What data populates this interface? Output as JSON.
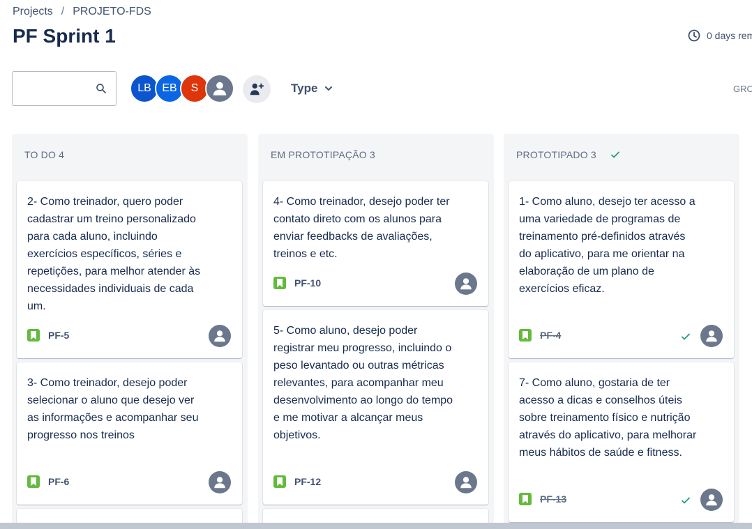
{
  "breadcrumb": {
    "projects": "Projects",
    "separator": "/",
    "project": "PROJETO-FDS"
  },
  "page_title": "PF Sprint 1",
  "sprint_time": {
    "text": "0 days rem",
    "icon": "clock-icon"
  },
  "search": {
    "value": "",
    "placeholder": ""
  },
  "avatars": [
    {
      "initials": "LB",
      "color": "#0c55cf"
    },
    {
      "initials": "EB",
      "color": "#0b66e4"
    },
    {
      "initials": "S",
      "color": "#de350b"
    },
    {
      "initials": "",
      "icon": "user-icon",
      "color": "#6b778c"
    }
  ],
  "filters": {
    "type_label": "Type",
    "group_label": "GRO"
  },
  "colors": {
    "story": "#63ba3c",
    "done_check": "#22a06b",
    "column_bg": "#f4f5f7"
  },
  "columns": [
    {
      "title": "TO DO 4",
      "cards": [
        {
          "text": "2- Como treinador, quero poder cadastrar um treino personalizado para cada aluno, incluindo exercícios específicos, séries e repetições, para melhor atender às necessidades individuais de cada um.",
          "key": "PF-5",
          "done": false
        },
        {
          "text": "3- Como treinador, desejo poder selecionar o aluno que desejo ver as informações e acompanhar seu progresso nos treinos",
          "key": "PF-6",
          "done": false
        }
      ]
    },
    {
      "title": "EM PROTOTIPAÇÃO 3",
      "cards": [
        {
          "text": "4- Como treinador, desejo poder ter contato direto com os alunos para enviar feedbacks de avaliações, treinos e etc.",
          "key": "PF-10",
          "done": false
        },
        {
          "text": "5- Como aluno, desejo poder registrar meu progresso, incluindo o peso levantado ou outras métricas relevantes, para acompanhar meu desenvolvimento ao longo do tempo e me motivar a alcançar meus objetivos.",
          "key": "PF-12",
          "done": false
        }
      ]
    },
    {
      "title": "PROTOTIPADO 3",
      "cards": [
        {
          "text": "1- Como aluno, desejo ter acesso a uma variedade de programas de treinamento pré-definidos através do aplicativo, para me orientar na elaboração de um plano de exercícios eficaz.",
          "key": "PF-4",
          "done": true
        },
        {
          "text": "7- Como aluno, gostaria de ter acesso a dicas e conselhos úteis sobre treinamento físico e nutrição através do aplicativo, para melhorar meus hábitos de saúde e fitness.",
          "key": "PF-13",
          "done": true
        }
      ]
    }
  ]
}
